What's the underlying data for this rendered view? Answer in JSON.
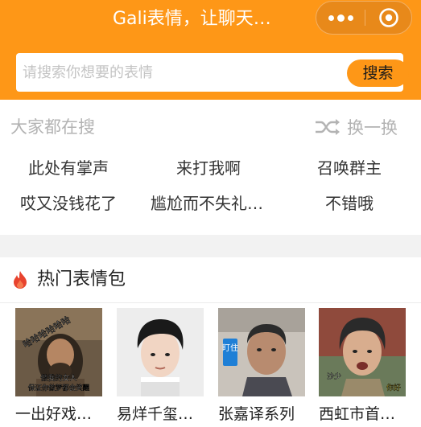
{
  "header": {
    "title": "Gali表情，让聊天…",
    "more_icon": "more-dots-icon",
    "close_icon": "target-close-icon"
  },
  "search": {
    "placeholder": "请搜索你想要的表情",
    "button_label": "搜索"
  },
  "hot_search": {
    "title": "大家都在搜",
    "refresh_label": "换一换",
    "keywords": [
      "此处有掌声",
      "来打我啊",
      "召唤群主",
      "哎又没钱花了",
      "尴尬而不失礼…",
      "不错哦"
    ]
  },
  "hot_packs": {
    "title": "热门表情包",
    "items": [
      {
        "label": "一出好戏…",
        "sticker_text": [
          "哈哈哈哈哈哈",
          "做我的女人",
          "保证你做梦都会笑醒"
        ]
      },
      {
        "label": "易烊千玺…"
      },
      {
        "label": "张嘉译系列",
        "sticker_text": [
          "盯住"
        ]
      },
      {
        "label": "西虹市首…",
        "sticker_text": [
          "沙少",
          "你好"
        ]
      }
    ]
  },
  "colors": {
    "brand_orange": "#fe9717",
    "page_gray": "#f2f2f2",
    "flame_red": "#e8432e"
  }
}
